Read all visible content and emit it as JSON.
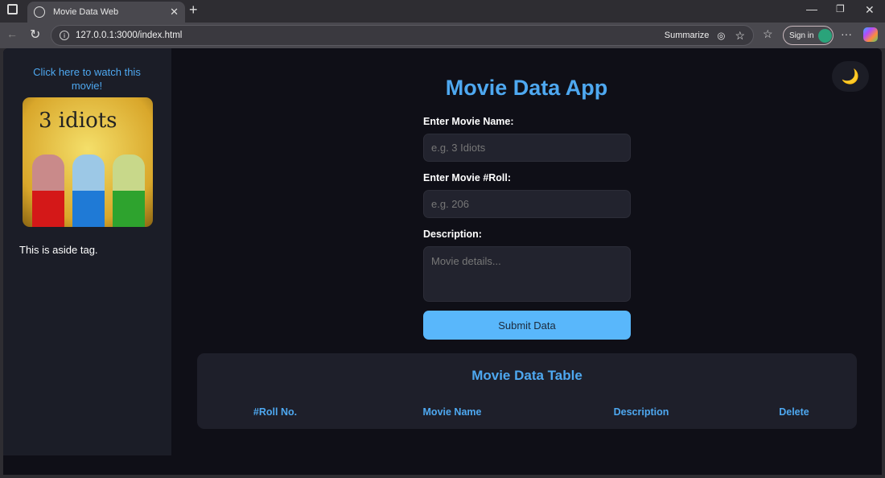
{
  "browser": {
    "tab_title": "Movie Data Web",
    "url": "127.0.0.1:3000/index.html",
    "summarize": "Summarize",
    "sign_in": "Sign in"
  },
  "sidebar": {
    "watch_link": "Click here to watch this movie!",
    "poster_title": "3 idiots",
    "aside_text": "This is aside tag."
  },
  "theme_toggle": "🌙",
  "main": {
    "title": "Movie Data App",
    "form": {
      "name_label": "Enter Movie Name:",
      "name_placeholder": "e.g. 3 Idiots",
      "roll_label": "Enter Movie #Roll:",
      "roll_placeholder": "e.g. 206",
      "desc_label": "Description:",
      "desc_placeholder": "Movie details...",
      "submit": "Submit Data"
    },
    "table": {
      "title": "Movie Data Table",
      "headers": [
        "#Roll No.",
        "Movie Name",
        "Description",
        "Delete"
      ]
    }
  }
}
